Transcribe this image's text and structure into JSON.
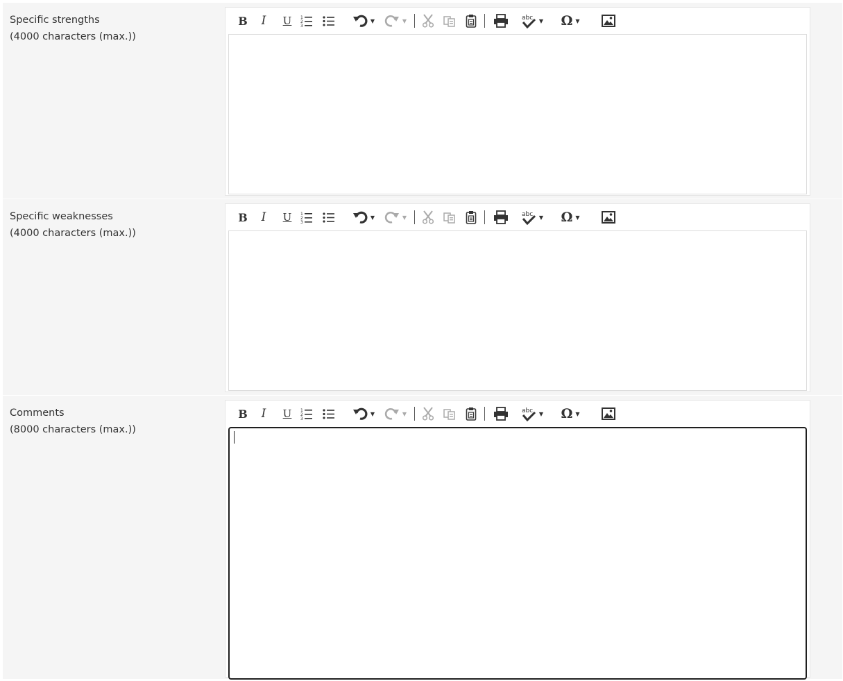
{
  "fields": [
    {
      "label": "Specific strengths",
      "hint": "(4000 characters (max.))",
      "value": "",
      "focused": false
    },
    {
      "label": "Specific weaknesses",
      "hint": "(4000 characters (max.))",
      "value": "",
      "focused": false
    },
    {
      "label": "Comments",
      "hint": "(8000 characters (max.))",
      "value": "",
      "focused": true
    }
  ],
  "toolbar": {
    "bold": "B",
    "italic": "I",
    "underline": "U",
    "special_char": "Ω",
    "icons": [
      "bold-icon",
      "italic-icon",
      "underline-icon",
      "numbered-list-icon",
      "bulleted-list-icon",
      "undo-icon",
      "redo-icon",
      "cut-icon",
      "copy-icon",
      "paste-icon",
      "print-icon",
      "spellcheck-icon",
      "omega-icon",
      "image-icon"
    ]
  },
  "colors": {
    "row_background": "#f5f5f5",
    "editor_border": "#dcdcdc",
    "focus_border": "#1f1f1f",
    "icon": "#333333",
    "icon_disabled": "#aaaaaa"
  }
}
